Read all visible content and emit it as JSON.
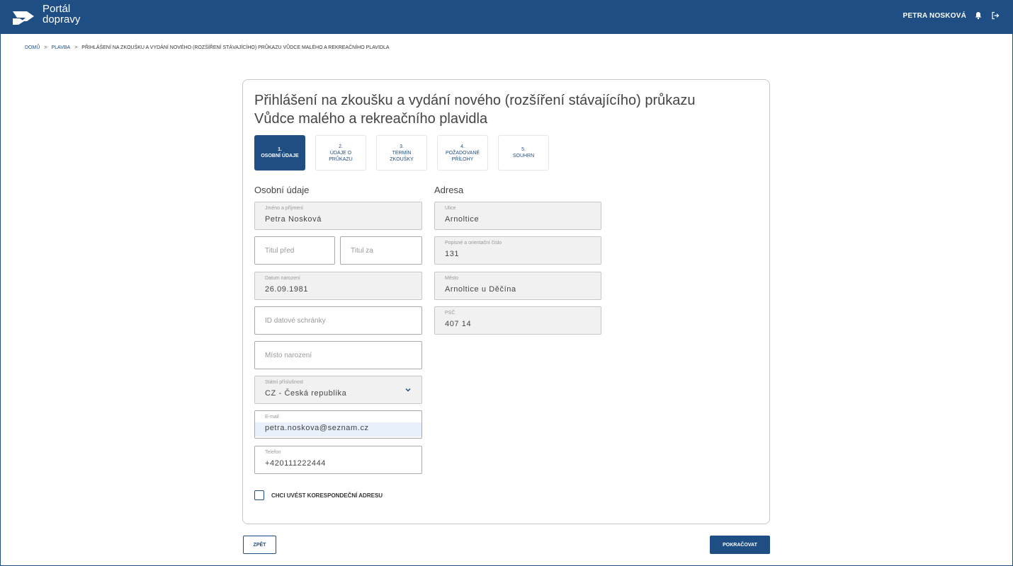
{
  "header": {
    "brand_line1": "Portál",
    "brand_line2": "dopravy",
    "user_name": "PETRA NOSKOVÁ",
    "logo_icon": "arrow-logo-icon",
    "bell_icon": "bell-icon",
    "logout_icon": "logout-icon",
    "color": "#1e4e83"
  },
  "breadcrumb": {
    "home": "DOMŮ",
    "section": "PLAVBA",
    "current": "PŘIHLÁŠENÍ NA ZKOUŠKU A VYDÁNÍ NOVÉHO (ROZŠÍŘENÍ STÁVAJÍCÍHO) PRŮKAZU VŮDCE MALÉHO A REKREAČNÍHO PLAVIDLA",
    "separator": ">"
  },
  "form": {
    "title_line1": "Přihlášení na zkoušku a vydání nového (rozšíření stávajícího) průkazu",
    "title_line2": "Vůdce malého a rekreačního plavidla",
    "steps": [
      {
        "num": "1.",
        "label": "OSOBNÍ ÚDAJE",
        "active": true
      },
      {
        "num": "2.",
        "label": "ÚDAJE O PRŮKAZU",
        "active": false
      },
      {
        "num": "3.",
        "label": "TERMÍN ZKOUŠKY",
        "active": false
      },
      {
        "num": "4.",
        "label": "POŽADOVANÉ PŘÍLOHY",
        "active": false
      },
      {
        "num": "5.",
        "label": "SOUHRN",
        "active": false
      }
    ],
    "personal": {
      "section_title": "Osobní údaje",
      "name_label": "Jméno a příjmení",
      "name_value": "Petra Nosková",
      "title_before_placeholder": "Titul před",
      "title_after_placeholder": "Titul za",
      "birth_label": "Datum narození",
      "birth_value": "26.09.1981",
      "databox_placeholder": "ID datové schránky",
      "birthplace_placeholder": "Místo narození",
      "citizenship_label": "Státní příslušnost",
      "citizenship_value": "CZ - Česká republika",
      "email_label": "E-mail",
      "email_value": "petra.noskova@seznam.cz",
      "phone_label": "Telefon",
      "phone_value": "+420111222444"
    },
    "address": {
      "section_title": "Adresa",
      "street_label": "Ulice",
      "street_value": "Arnoltice",
      "number_label": "Popisné a orientační číslo",
      "number_value": "131",
      "city_label": "Město",
      "city_value": "Arnoltice u Děčína",
      "zip_label": "PSČ",
      "zip_value": "407 14"
    },
    "checkbox_label": "CHCI UVÉST KORESPONDEČNÍ ADRESU"
  },
  "buttons": {
    "back": "ZPĚT",
    "next": "POKRAČOVAT"
  }
}
